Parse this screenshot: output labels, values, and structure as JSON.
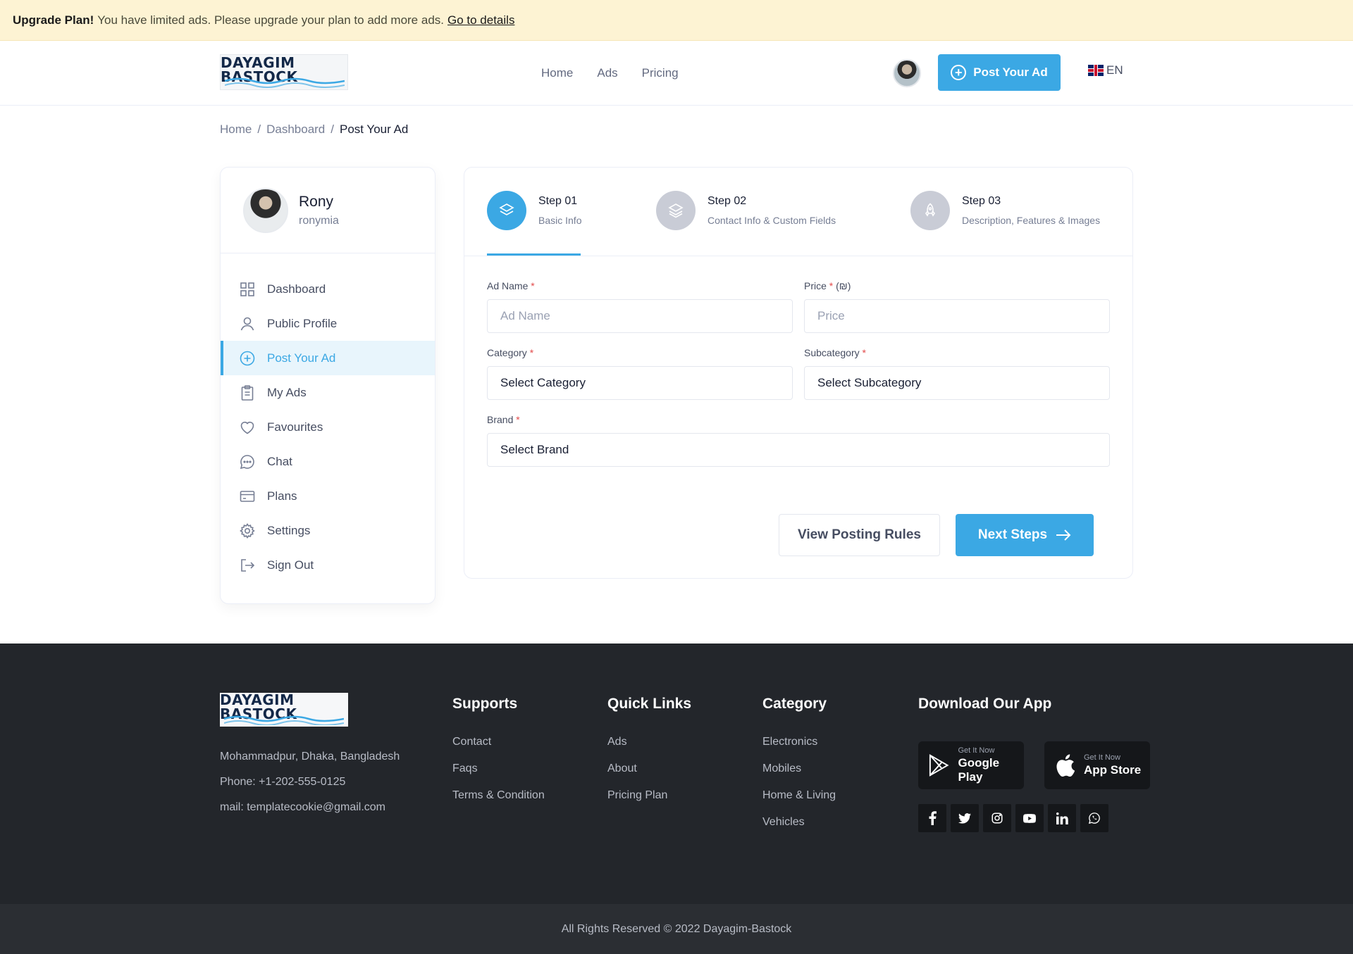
{
  "alert": {
    "title": "Upgrade Plan!",
    "message": "You have limited ads. Please upgrade your plan to add more ads.",
    "link": "Go to details"
  },
  "header": {
    "logo_text": "DAYAGIM BASTOCK",
    "nav": [
      "Home",
      "Ads",
      "Pricing"
    ],
    "post_button": "Post Your Ad",
    "lang": "EN"
  },
  "breadcrumb": [
    "Home",
    "Dashboard",
    "Post Your Ad"
  ],
  "profile": {
    "name": "Rony",
    "username": "ronymia"
  },
  "sidebar": {
    "items": [
      {
        "label": "Dashboard",
        "icon": "grid-icon"
      },
      {
        "label": "Public Profile",
        "icon": "user-icon"
      },
      {
        "label": "Post Your Ad",
        "icon": "plus-circle-icon",
        "active": true
      },
      {
        "label": "My Ads",
        "icon": "clipboard-icon"
      },
      {
        "label": "Favourites",
        "icon": "heart-icon"
      },
      {
        "label": "Chat",
        "icon": "chat-icon"
      },
      {
        "label": "Plans",
        "icon": "credit-card-icon"
      },
      {
        "label": "Settings",
        "icon": "gear-icon"
      },
      {
        "label": "Sign Out",
        "icon": "sign-out-icon"
      }
    ]
  },
  "steps": [
    {
      "title": "Step 01",
      "subtitle": "Basic Info",
      "active": true
    },
    {
      "title": "Step 02",
      "subtitle": "Contact Info & Custom Fields"
    },
    {
      "title": "Step 03",
      "subtitle": "Description, Features & Images"
    }
  ],
  "form": {
    "ad_name": {
      "label": "Ad Name",
      "placeholder": "Ad Name"
    },
    "price": {
      "label": "Price",
      "unit": "(₪)",
      "placeholder": "Price"
    },
    "category": {
      "label": "Category",
      "value": "Select Category"
    },
    "subcategory": {
      "label": "Subcategory",
      "value": "Select Subcategory"
    },
    "brand": {
      "label": "Brand",
      "value": "Select Brand"
    },
    "required_mark": "*"
  },
  "buttons": {
    "rules": "View Posting Rules",
    "next": "Next Steps"
  },
  "footer": {
    "address": "Mohammadpur, Dhaka, Bangladesh",
    "phone": "Phone: +1-202-555-0125",
    "mail": "mail: templatecookie@gmail.com",
    "supports": {
      "title": "Supports",
      "links": [
        "Contact",
        "Faqs",
        "Terms & Condition"
      ]
    },
    "quick": {
      "title": "Quick Links",
      "links": [
        "Ads",
        "About",
        "Pricing Plan"
      ]
    },
    "category": {
      "title": "Category",
      "links": [
        "Electronics",
        "Mobiles",
        "Home & Living",
        "Vehicles"
      ]
    },
    "app": {
      "title": "Download Our App",
      "google": {
        "small": "Get It Now",
        "big": "Google Play"
      },
      "apple": {
        "small": "Get It Now",
        "big": "App Store"
      }
    },
    "copyright": "All Rights Reserved © 2022 Dayagim-Bastock"
  },
  "colors": {
    "accent": "#3ba8e4",
    "footer_bg": "#23262b",
    "alert_bg": "#fdf3d3"
  }
}
